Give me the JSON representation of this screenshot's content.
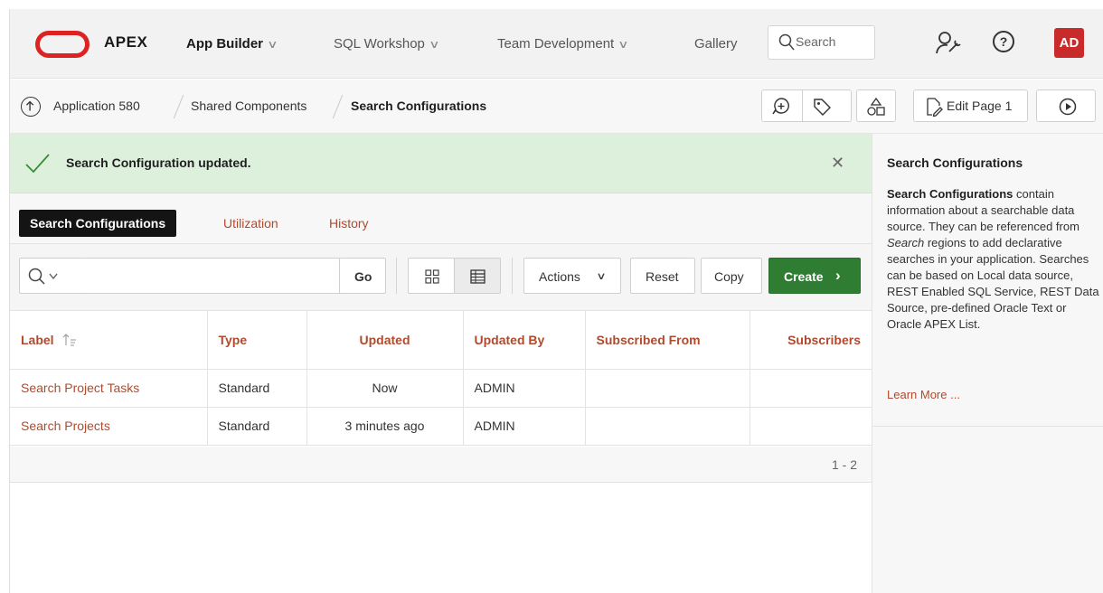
{
  "nav": {
    "brand": "APEX",
    "menus": [
      {
        "label": "App Builder",
        "chevron": "∨"
      },
      {
        "label": "SQL Workshop",
        "chevron": "∨"
      },
      {
        "label": "Team Development",
        "chevron": "∨"
      },
      {
        "label": "Gallery"
      }
    ],
    "search_placeholder": "Search",
    "help_glyph": "?",
    "avatar_initials": "AD"
  },
  "breadcrumb": {
    "items": [
      "Application 580",
      "Shared Components",
      "Search Configurations"
    ],
    "edit_page_label": "Edit Page 1"
  },
  "alert": {
    "message": "Search Configuration updated.",
    "close_glyph": "✕"
  },
  "tabs": [
    "Search Configurations",
    "Utilization",
    "History"
  ],
  "toolbar": {
    "search_value": "",
    "go_label": "Go",
    "actions_label": "Actions",
    "actions_chevron": "∨",
    "reset_label": "Reset",
    "copy_label": "Copy",
    "create_label": "Create",
    "create_chevron": "›"
  },
  "table": {
    "columns": [
      "Label",
      "Type",
      "Updated",
      "Updated By",
      "Subscribed From",
      "Subscribers"
    ],
    "rows": [
      {
        "label": "Search Project Tasks",
        "type": "Standard",
        "updated": "Now",
        "updated_by": "ADMIN",
        "subscribed_from": "",
        "subscribers": ""
      },
      {
        "label": "Search Projects",
        "type": "Standard",
        "updated": "3 minutes ago",
        "updated_by": "ADMIN",
        "subscribed_from": "",
        "subscribers": ""
      }
    ],
    "pagination": "1 - 2"
  },
  "help": {
    "title": "Search Configurations",
    "body_bold": "Search Configurations",
    "body_1": " contain information about a searchable data source. They can be referenced from ",
    "body_italic": "Search",
    "body_2": " regions to add declarative searches in your application. Searches can be based on Local data source, REST Enabled SQL Service, REST Data Source, pre-defined Oracle Text or Oracle APEX List.",
    "learn_more": "Learn More ..."
  },
  "colors": {
    "accent_link": "#b14a2d",
    "create_button": "#2e7d32",
    "alert_bg": "#dcf0dc",
    "avatar_bg": "#c92b2b",
    "logo_red": "#dd2222"
  },
  "icons": [
    "oracle-logo-icon",
    "search-icon",
    "admin-wrench-icon",
    "help-icon",
    "up-arrow-icon",
    "feedback-plus-icon",
    "tag-icon",
    "shapes-icon",
    "edit-page-icon",
    "run-play-icon",
    "checkmark-icon",
    "close-icon",
    "grid-view-icon",
    "report-view-icon"
  ]
}
